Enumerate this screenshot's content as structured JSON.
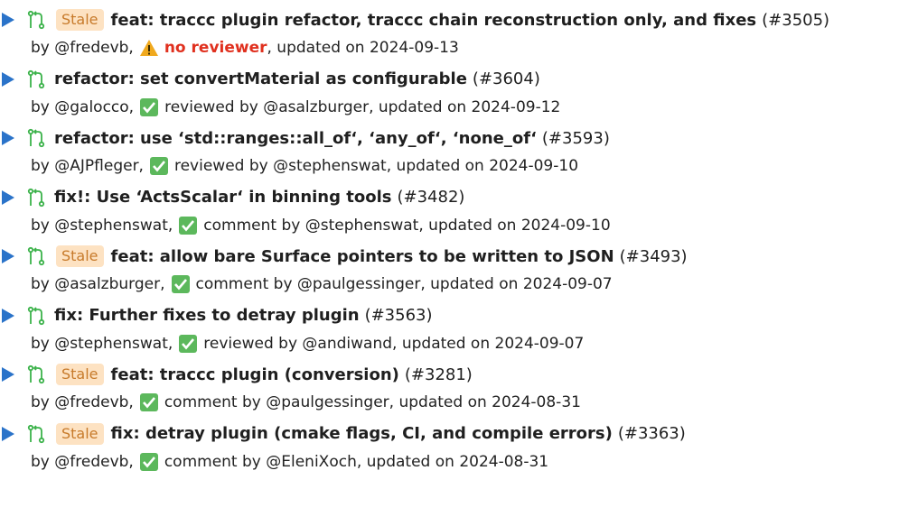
{
  "colors": {
    "arrow": "#2a73c9",
    "stale_bg": "#fde2c2",
    "stale_text": "#c77a2a",
    "check_bg": "#5cb85c",
    "warning": "#f0a91e",
    "no_reviewer": "#e0301e"
  },
  "items": [
    {
      "stale": "Stale",
      "title": "feat: traccc plugin refactor, traccc chain reconstruction only, and fixes",
      "number": "(#3505)",
      "author": "by @fredevb,",
      "status_icon": "warning-icon",
      "review": "no reviewer",
      "updated": ", updated on 2024-09-13"
    },
    {
      "stale": "",
      "title": "refactor: set convertMaterial as configurable",
      "number": "(#3604)",
      "author": "by @galocco,",
      "status_icon": "check-icon",
      "review": "reviewed by @asalzburger",
      "updated": ", updated on 2024-09-12"
    },
    {
      "stale": "",
      "title": "refactor: use ‘std::ranges::all_of‘, ‘any_of‘, ‘none_of‘",
      "number": "(#3593)",
      "author": "by @AJPfleger,",
      "status_icon": "check-icon",
      "review": "reviewed by @stephenswat",
      "updated": ", updated on 2024-09-10"
    },
    {
      "stale": "",
      "title": "fix!: Use ‘ActsScalar‘ in binning tools",
      "number": "(#3482)",
      "author": "by @stephenswat,",
      "status_icon": "check-icon",
      "review": "comment by @stephenswat",
      "updated": ", updated on 2024-09-10"
    },
    {
      "stale": "Stale",
      "title": "feat: allow bare Surface pointers to be written to JSON",
      "number": "(#3493)",
      "author": "by @asalzburger,",
      "status_icon": "check-icon",
      "review": "comment by @paulgessinger",
      "updated": ", updated on 2024-09-07"
    },
    {
      "stale": "",
      "title": "fix: Further fixes to detray plugin",
      "number": "(#3563)",
      "author": "by @stephenswat,",
      "status_icon": "check-icon",
      "review": "reviewed by @andiwand",
      "updated": ", updated on 2024-09-07"
    },
    {
      "stale": "Stale",
      "title": "feat: traccc plugin (conversion)",
      "number": "(#3281)",
      "author": "by @fredevb,",
      "status_icon": "check-icon",
      "review": "comment by @paulgessinger",
      "updated": ", updated on 2024-08-31"
    },
    {
      "stale": "Stale",
      "title": "fix: detray plugin (cmake flags, CI, and compile errors)",
      "number": "(#3363)",
      "author": "by @fredevb,",
      "status_icon": "check-icon",
      "review": "comment by @EleniXoch",
      "updated": ", updated on 2024-08-31"
    }
  ]
}
